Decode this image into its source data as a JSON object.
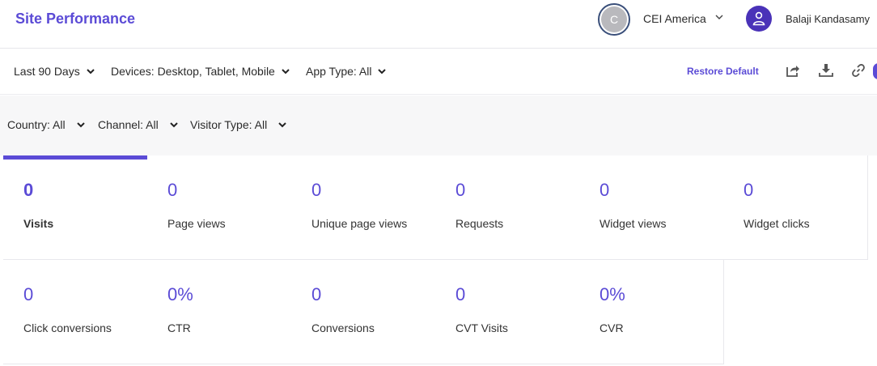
{
  "header": {
    "title": "Site Performance",
    "org_initial": "C",
    "org_name": "CEI America",
    "user_name": "Balaji Kandasamy"
  },
  "filters_row1": {
    "date_range": "Last 90 Days",
    "devices": "Devices: Desktop, Tablet, Mobile",
    "app_type": "App Type: All",
    "restore_label": "Restore Default"
  },
  "filters_row2": {
    "country": "Country: All",
    "channel": "Channel: All",
    "visitor_type": "Visitor Type: All"
  },
  "metrics": [
    {
      "value": "0",
      "label": "Visits",
      "active": true
    },
    {
      "value": "0",
      "label": "Page views"
    },
    {
      "value": "0",
      "label": "Unique page views"
    },
    {
      "value": "0",
      "label": "Requests"
    },
    {
      "value": "0",
      "label": "Widget views"
    },
    {
      "value": "0",
      "label": "Widget clicks"
    },
    {
      "value": "0",
      "label": "Click conversions"
    },
    {
      "value": "0%",
      "label": "CTR"
    },
    {
      "value": "0",
      "label": "Conversions"
    },
    {
      "value": "0",
      "label": "CVT Visits"
    },
    {
      "value": "0%",
      "label": "CVR"
    }
  ],
  "colors": {
    "accent": "#5b4bd6",
    "user_avatar": "#4a32b8"
  },
  "icons": [
    "chevron-down-icon",
    "user-icon",
    "share-icon",
    "download-icon",
    "link-icon"
  ]
}
